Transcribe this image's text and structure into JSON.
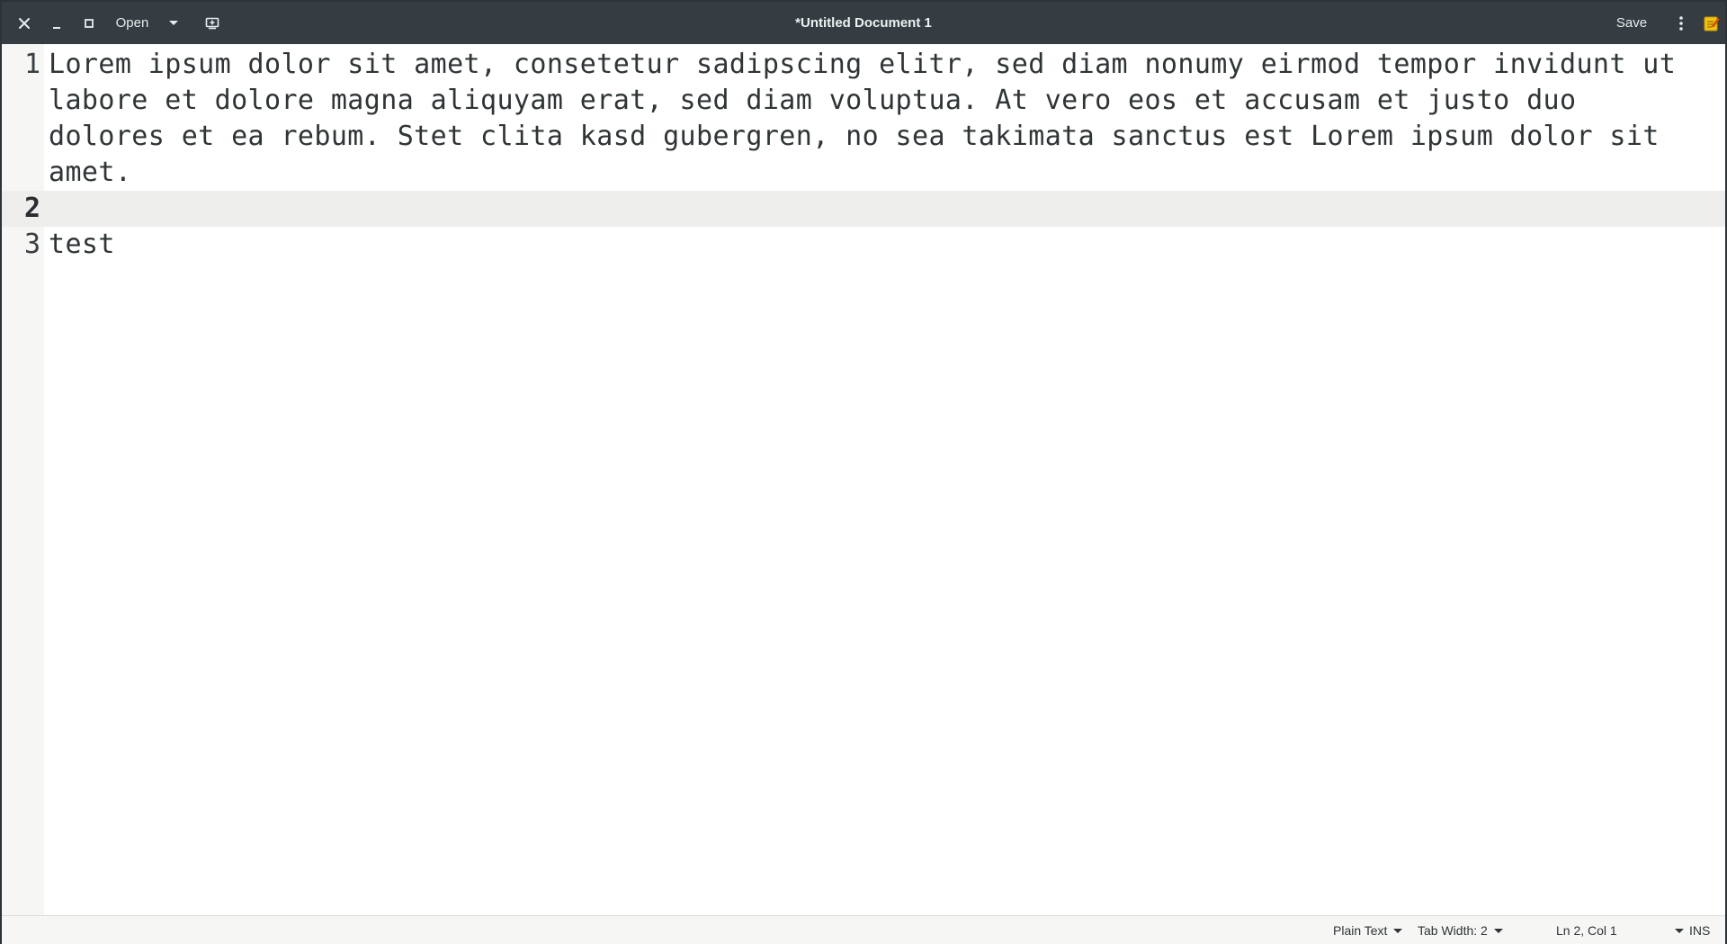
{
  "window": {
    "title": "*Untitled Document 1"
  },
  "headerbar": {
    "open_label": "Open",
    "save_label": "Save"
  },
  "editor": {
    "current_line": 2,
    "lines": [
      {
        "number": "1",
        "text": "Lorem ipsum dolor sit amet, consetetur sadipscing elitr, sed diam nonumy eirmod tempor invidunt ut labore et dolore magna aliquyam erat, sed diam voluptua. At vero eos et accusam et justo duo dolores et ea rebum. Stet clita kasd gubergren, no sea takimata sanctus est Lorem ipsum dolor sit amet."
      },
      {
        "number": "2",
        "text": ""
      },
      {
        "number": "3",
        "text": "test"
      }
    ]
  },
  "statusbar": {
    "language": "Plain Text",
    "tab_width": "Tab Width: 2",
    "position": "Ln 2, Col 1",
    "mode": "INS"
  },
  "colors": {
    "headerbar_bg": "#353d42",
    "current_line_bg": "#eeeeec",
    "note_icon_accent": "#f5c211"
  },
  "icons": {
    "close": "close-icon",
    "minimize": "minimize-icon",
    "maximize": "maximize-icon",
    "open_dropdown": "chevron-down-icon",
    "new_document": "new-document-icon",
    "menu": "vertical-dots-menu-icon",
    "app": "text-editor-app-icon"
  }
}
